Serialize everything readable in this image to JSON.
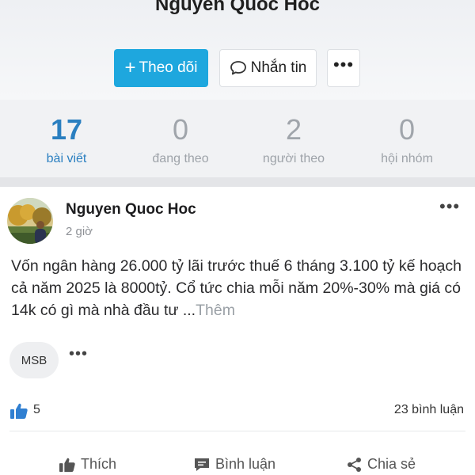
{
  "profile": {
    "name": "Nguyen Quoc Hoc",
    "follow_label": "Theo dõi",
    "message_label": "Nhắn tin",
    "more_label": "•••"
  },
  "stats": [
    {
      "value": "17",
      "label": "bài viết"
    },
    {
      "value": "0",
      "label": "đang theo"
    },
    {
      "value": "2",
      "label": "người theo"
    },
    {
      "value": "0",
      "label": "hội nhóm"
    }
  ],
  "post": {
    "author": "Nguyen Quoc Hoc",
    "time": "2 giờ",
    "content": "Vốn ngân hàng 26.000 tỷ lãi trước thuế 6 tháng 3.100 tỷ kế hoạch cả năm 2025 là 8000tỷ. Cổ tức chia mỗi năm 20%-30% mà giá có 14k có gì mà nhà đầu tư ...",
    "more_link": "Thêm",
    "tag": "MSB",
    "likes": "5",
    "comments": "23 bình luận",
    "actions": {
      "like": "Thích",
      "comment": "Bình luận",
      "share": "Chia sẻ"
    }
  },
  "icons": {
    "plus": "plus-icon",
    "message": "chat-bubble-icon",
    "more": "ellipsis-icon",
    "like": "thumbs-up-icon",
    "comment": "comment-icon",
    "share": "share-icon"
  },
  "colors": {
    "accent": "#1ea7de",
    "active_stat": "#2a7fc0",
    "like_blue": "#2f7fd1"
  }
}
